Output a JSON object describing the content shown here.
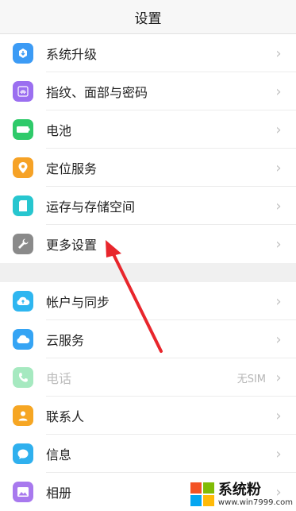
{
  "title": "设置",
  "group1": [
    {
      "label": "系统升级",
      "icon": "system-update-icon",
      "color": "#3c9bf5"
    },
    {
      "label": "指纹、面部与密码",
      "icon": "fingerprint-icon",
      "color": "#9b6ff0"
    },
    {
      "label": "电池",
      "icon": "battery-icon",
      "color": "#2fca6a"
    },
    {
      "label": "定位服务",
      "icon": "location-icon",
      "color": "#f6a226"
    },
    {
      "label": "运存与存储空间",
      "icon": "storage-icon",
      "color": "#27c6cf"
    },
    {
      "label": "更多设置",
      "icon": "wrench-icon",
      "color": "#8a8a8a"
    }
  ],
  "group2": [
    {
      "label": "帐户与同步",
      "icon": "account-sync-icon",
      "color": "#2eb6f0"
    },
    {
      "label": "云服务",
      "icon": "cloud-icon",
      "color": "#35a4f4"
    },
    {
      "label": "电话",
      "icon": "phone-icon",
      "color": "#3ccf75",
      "value": "无SIM",
      "disabled": true
    },
    {
      "label": "联系人",
      "icon": "contacts-icon",
      "color": "#f6a623"
    },
    {
      "label": "信息",
      "icon": "message-icon",
      "color": "#2fb0ee"
    },
    {
      "label": "相册",
      "icon": "gallery-icon",
      "color": "#a879ee"
    }
  ],
  "chevron": "›",
  "watermark": {
    "brand": "系统粉",
    "url": "www.win7999.com"
  }
}
